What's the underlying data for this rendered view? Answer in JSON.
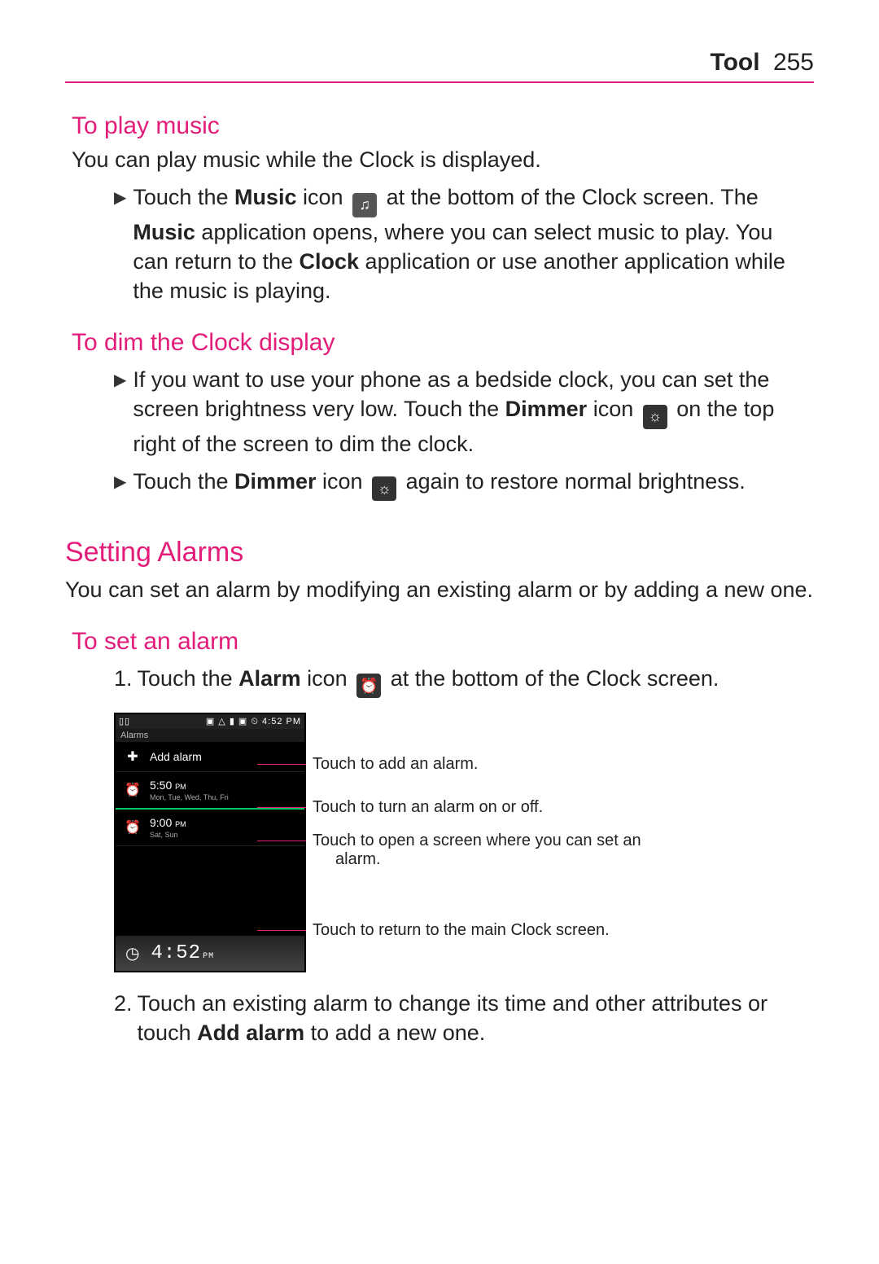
{
  "header": {
    "chapter": "Tool",
    "page": "255"
  },
  "s1": {
    "title": "To play music",
    "intro": "You can play music while the Clock is displayed.",
    "b1_a": "Touch the ",
    "b1_b": "Music",
    "b1_c": " icon ",
    "b1_d": " at the bottom of the Clock screen. The ",
    "b1_e": "Music",
    "b1_f": " application opens, where you can select music to play. You can return to the ",
    "b1_g": "Clock",
    "b1_h": " application or use another application while the music is playing."
  },
  "s2": {
    "title": "To dim the Clock display",
    "b1_a": "If you want to use your phone as a bedside clock, you can set the screen brightness very low. Touch the ",
    "b1_b": "Dimmer",
    "b1_c": " icon ",
    "b1_d": " on the top right of the screen to dim the clock.",
    "b2_a": "Touch the ",
    "b2_b": "Dimmer",
    "b2_c": " icon ",
    "b2_d": " again to restore normal brightness."
  },
  "s3": {
    "title": "Setting Alarms",
    "intro": "You can set an alarm by modifying an existing alarm or by adding a new one."
  },
  "s4": {
    "title": "To set an alarm",
    "step1_a": "Touch the ",
    "step1_b": "Alarm",
    "step1_c": " icon ",
    "step1_d": " at the bottom of the Clock screen.",
    "step2_a": "Touch an existing alarm to change its time and other attributes or touch ",
    "step2_b": "Add alarm",
    "step2_c": " to add a new one."
  },
  "shot": {
    "status_time": "4:52 PM",
    "section": "Alarms",
    "add": "Add alarm",
    "a1_time": "5:50",
    "a1_pm": "PM",
    "a1_days": "Mon, Tue, Wed, Thu, Fri",
    "a2_time": "9:00",
    "a2_pm": "PM",
    "a2_days": "Sat, Sun",
    "bottom_time": "4:52",
    "bottom_pm": "PM",
    "callout1": "Touch to add an alarm.",
    "callout2": "Touch to turn an alarm on or off.",
    "callout3": "Touch to open a screen where you can set an alarm.",
    "callout4": "Touch to return to the main Clock screen."
  }
}
